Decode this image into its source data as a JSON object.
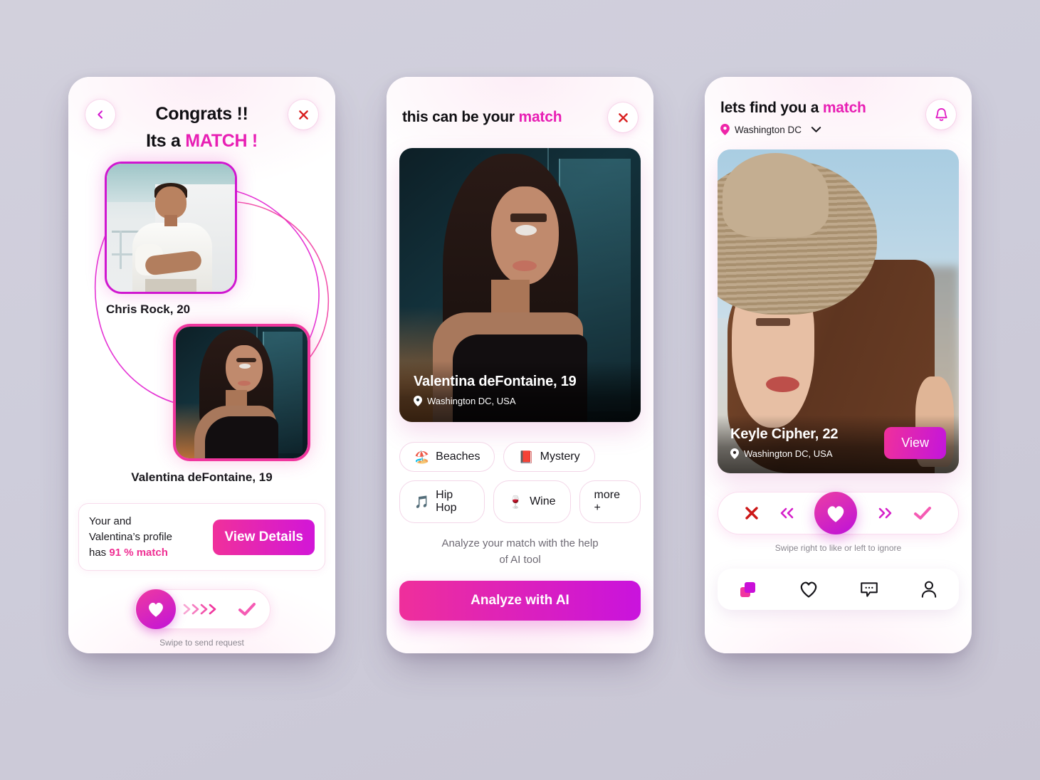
{
  "theme": {
    "background": "#cecddb",
    "magenta": "#e81fb4",
    "pink": "#ef2f93",
    "purple": "#c913dd",
    "red": "#d81f1f",
    "muted": "#8b8790"
  },
  "screen1": {
    "back_icon": "chevron-left-icon",
    "close_icon": "close-icon",
    "title_line1": "Congrats !!",
    "title_line2_prefix": "Its a ",
    "title_line2_highlight": "MATCH !",
    "profile_a": {
      "name": "Chris Rock, 20",
      "photo": "man-in-white-shirt"
    },
    "profile_b": {
      "name": "Valentina deFontaine, 19",
      "photo": "woman-night-portrait"
    },
    "match_card": {
      "line1": "Your and",
      "line2": "Valentina’s profile",
      "line3_prefix": "has ",
      "line3_highlight": "91 % match",
      "button_label": "View Details"
    },
    "swipe": {
      "heart_icon": "heart-filled-icon",
      "chevrons_icon": "triple-chevron-right-icon",
      "check_icon": "check-icon",
      "hint": "Swipe to send request"
    }
  },
  "screen2": {
    "title_prefix": "this can be your ",
    "title_highlight": "match",
    "close_icon": "close-icon",
    "profile": {
      "name": "Valentina deFontaine, 19",
      "location": "Washington DC, USA",
      "location_icon": "map-pin-icon",
      "photo": "woman-night-portrait"
    },
    "tags": [
      {
        "emoji": "🏖️",
        "label": "Beaches",
        "icon": "beach-icon"
      },
      {
        "emoji": "📕",
        "label": "Mystery",
        "icon": "book-icon"
      },
      {
        "emoji": "🎵",
        "label": "Hip Hop",
        "icon": "music-note-icon"
      },
      {
        "emoji": "🍷",
        "label": "Wine",
        "icon": "wine-glass-icon"
      },
      {
        "emoji": "",
        "label": "more +",
        "icon": "more-icon"
      }
    ],
    "ai_note_line1": "Analyze your match with the help",
    "ai_note_line2": "of AI tool",
    "cta_label": "Analyze with AI"
  },
  "screen3": {
    "title_prefix": "lets find you a ",
    "title_highlight": "match",
    "bell_icon": "bell-icon",
    "location": "Washington DC",
    "location_icon": "map-pin-icon",
    "chevron_icon": "chevron-down-icon",
    "profile": {
      "name": "Keyle Cipher, 22",
      "location": "Washington DC, USA",
      "location_icon": "map-pin-icon",
      "photo": "woman-with-straw-hat",
      "view_label": "View"
    },
    "actions": {
      "reject_icon": "close-icon",
      "prev_icon": "double-chevron-left-icon",
      "like_icon": "heart-filled-icon",
      "next_icon": "double-chevron-right-icon",
      "accept_icon": "check-icon",
      "hint": "Swipe right  to like or left to ignore"
    },
    "tabs": [
      {
        "icon": "cards-stack-icon",
        "active": true
      },
      {
        "icon": "heart-outline-icon",
        "active": false
      },
      {
        "icon": "chat-bubble-icon",
        "active": false
      },
      {
        "icon": "person-icon",
        "active": false
      }
    ]
  }
}
